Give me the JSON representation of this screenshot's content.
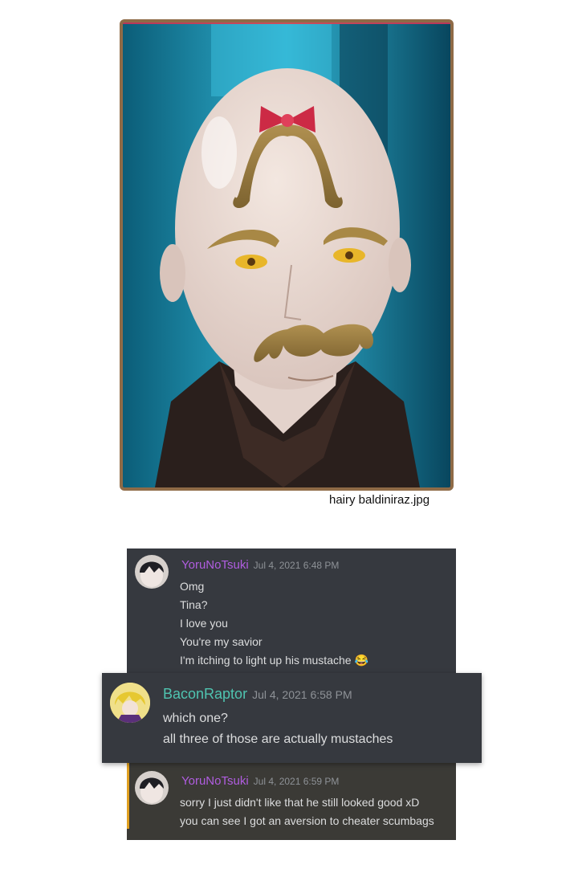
{
  "image": {
    "caption": "hairy baldiniraz.jpg"
  },
  "messages": [
    {
      "username": "YoruNoTsuki",
      "username_color": "#b05de0",
      "timestamp": "Jul 4, 2021 6:48 PM",
      "lines": [
        "Omg",
        "Tina?",
        "I love you",
        "You're my savior",
        "I'm itching to light up his mustache"
      ],
      "emoji": "😂"
    },
    {
      "username": "BaconRaptor",
      "username_color": "#4fc4b0",
      "timestamp": "Jul 4, 2021 6:58 PM",
      "lines": [
        "which one?",
        "all three of those are actually mustaches"
      ]
    },
    {
      "username": "YoruNoTsuki",
      "username_color": "#b05de0",
      "timestamp": "Jul 4, 2021 6:59 PM",
      "lines": [
        "sorry I just didn't like that he still looked good xD",
        "you can see I got an aversion to cheater scumbags"
      ]
    }
  ]
}
